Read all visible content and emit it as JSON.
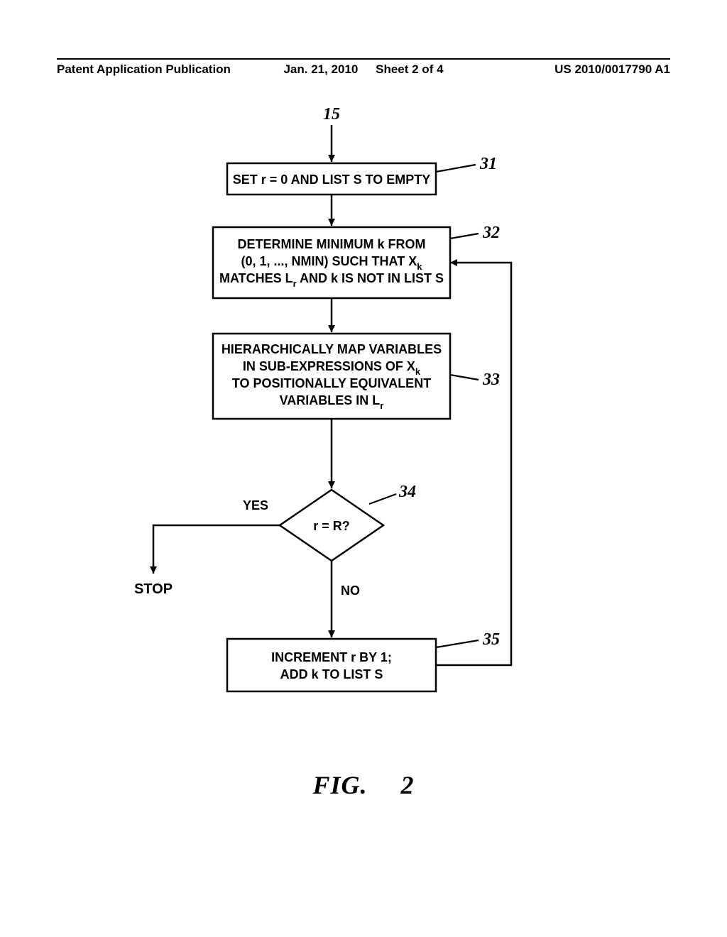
{
  "header": {
    "left": "Patent Application Publication",
    "date": "Jan. 21, 2010",
    "sheet": "Sheet 2 of 4",
    "pub": "US 2010/0017790 A1"
  },
  "diagram": {
    "entry_label": "15",
    "box31": {
      "text": "SET r = 0 AND LIST S TO EMPTY",
      "ref": "31"
    },
    "box32": {
      "line1": "DETERMINE MINIMUM k FROM",
      "line2a": "(0, 1, ..., NMIN) SUCH THAT X",
      "line2b": "k",
      "line3a": "MATCHES L",
      "line3b": "r",
      "line3c": " AND k IS NOT IN LIST S",
      "ref": "32"
    },
    "box33": {
      "line1": "HIERARCHICALLY MAP VARIABLES",
      "line2a": "IN SUB-EXPRESSIONS OF X",
      "line2b": "k",
      "line3": "TO POSITIONALLY EQUIVALENT",
      "line4a": "VARIABLES IN L",
      "line4b": "r",
      "ref": "33"
    },
    "decision34": {
      "text": "r = R?",
      "ref": "34",
      "yes": "YES",
      "no": "NO",
      "stop": "STOP"
    },
    "box35": {
      "line1": "INCREMENT r BY 1;",
      "line2": "ADD k TO LIST S",
      "ref": "35"
    }
  },
  "figure_caption": "FIG.  2"
}
